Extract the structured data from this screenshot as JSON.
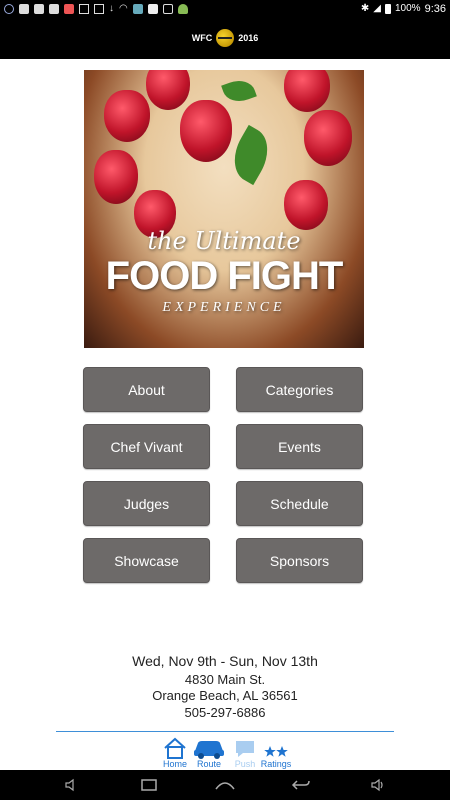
{
  "status_bar": {
    "left_icons": [
      "app-icon",
      "briefcase-icon",
      "briefcase-icon",
      "briefcase-icon",
      "image-icon",
      "mail-icon",
      "mail-icon",
      "download-icon",
      "wifi-icon",
      "photo-icon",
      "facebook-icon",
      "store-icon",
      "android-icon"
    ],
    "battery": "100%",
    "time": "9:36"
  },
  "header": {
    "brand_left": "WFC",
    "brand_right": "2016"
  },
  "hero": {
    "line1": "the Ultimate",
    "line2": "FOOD FIGHT",
    "line3": "EXPERIENCE"
  },
  "buttons": {
    "about": "About",
    "categories": "Categories",
    "chef_vivant": "Chef Vivant",
    "events": "Events",
    "judges": "Judges",
    "schedule": "Schedule",
    "showcase": "Showcase",
    "sponsors": "Sponsors"
  },
  "info": {
    "dates": "Wed, Nov 9th - Sun, Nov 13th",
    "street": "4830 Main St.",
    "city": "Orange Beach, AL 36561",
    "phone": "505-297-6886"
  },
  "tabs": {
    "home": "Home",
    "route": "Route",
    "push": "Push",
    "ratings": "Ratings"
  },
  "colors": {
    "button_bg": "#6d6a69",
    "tab_active": "#1f74d0",
    "tab_disabled": "#a9cdf0",
    "bar_bg": "#000000"
  }
}
